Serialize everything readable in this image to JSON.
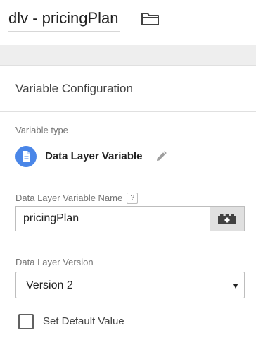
{
  "header": {
    "title": "dlv - pricingPlan"
  },
  "config": {
    "section_title": "Variable Configuration",
    "variable_type_label": "Variable type",
    "variable_type_name": "Data Layer Variable",
    "dlv_name_label": "Data Layer Variable Name",
    "dlv_name_help": "?",
    "dlv_name_value": "pricingPlan",
    "version_label": "Data Layer Version",
    "version_value": "Version 2",
    "default_value_label": "Set Default Value",
    "default_value_checked": false
  },
  "icons": {
    "folder": "folder-icon",
    "type": "document-icon",
    "edit": "pencil-icon",
    "variable": "lego-brick-add-icon",
    "dropdown": "triangle-down-icon"
  },
  "colors": {
    "type_icon_bg": "#4a86e8",
    "band_bg": "#eeeeee",
    "variable_button_bg": "#e0e0e0"
  }
}
